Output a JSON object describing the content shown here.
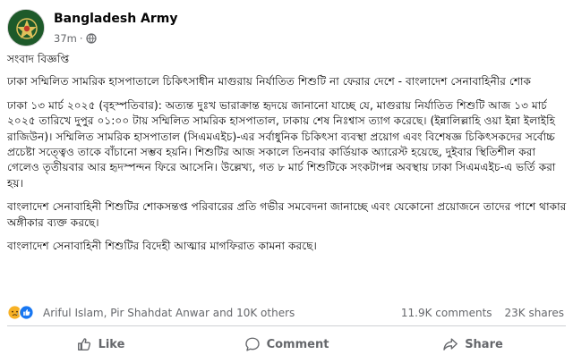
{
  "post": {
    "page_name": "Bangladesh Army",
    "time": "37m",
    "paragraphs": [
      "সংবাদ বিজ্ঞপ্তি",
      "ঢাকা সম্মিলিত সামরিক হাসপাতালে চিকিৎসাধীন মাগুরায় নির্যাতিত শিশুটি না ফেরার দেশে - বাংলাদেশ সেনাবাহিনীর শোক",
      "ঢাকা ১৩ মার্চ ২০২৫ (বৃহস্পতিবার): অত্যন্ত দুঃখ ভারাক্রান্ত হৃদয়ে জানানো যাচ্ছে যে, মাগুরায় নির্যাতিত শিশুটি আজ ১৩ মার্চ ২০২৫ তারিখে দুপুর ০১:০০ টায় সম্মিলিত সামরিক হাসপাতাল, ঢাকায় শেষ নিঃশ্বাস ত্যাগ করেছে। (ইন্নালিল্লাহি ওয়া ইন্না ইলাইহি রাজিউন)। সম্মিলিত সামরিক হাসপাতাল (সিএমএইচ)-এর সর্বাধুনিক চিকিৎসা ব্যবস্থা প্রয়োগ এবং বিশেষজ্ঞ চিকিৎসকদের সর্বোচ্চ প্রচেষ্টা সত্ত্বেও তাকে বাঁচানো সম্ভব হয়নি। শিশুটির আজ সকালে তিনবার কার্ডিয়াক অ্যারেস্ট হয়েছে, দুইবার স্থিতিশীল করা গেলেও তৃতীয়বার আর হৃদস্পন্দন ফিরে আসেনি। উল্লেখ্য, গত ৮ মার্চ শিশুটিকে সংকটাপন্ন অবস্থায় ঢাকা সিএমএইচ-এ ভর্তি করা হয়।",
      "বাংলাদেশ সেনাবাহিনী শিশুটির শোকসন্তপ্ত পরিবারের প্রতি গভীর সমবেদনা জানাচ্ছে এবং যেকোনো প্রয়োজনে তাদের পাশে থাকার অঙ্গীকার ব্যক্ত করছে।",
      "বাংলাদেশ সেনাবাহিনী শিশুটির বিদেহী আত্মার মাগফিরাত কামনা করছে।"
    ]
  },
  "reactions": {
    "names": "Ariful Islam, Pir Shahdat Anwar and 10K others",
    "comments": "11.9K comments",
    "shares": "23K shares",
    "icons": [
      "sad-reaction",
      "like-reaction"
    ]
  },
  "actions": {
    "like": "Like",
    "comment": "Comment",
    "share": "Share"
  },
  "colors": {
    "muted_text": "#65676b",
    "verified_blue": "#1877f2",
    "avatar_green": "#1e5a2a",
    "like_blue": "#1877f2",
    "sad_yellow": "#f7b125"
  }
}
